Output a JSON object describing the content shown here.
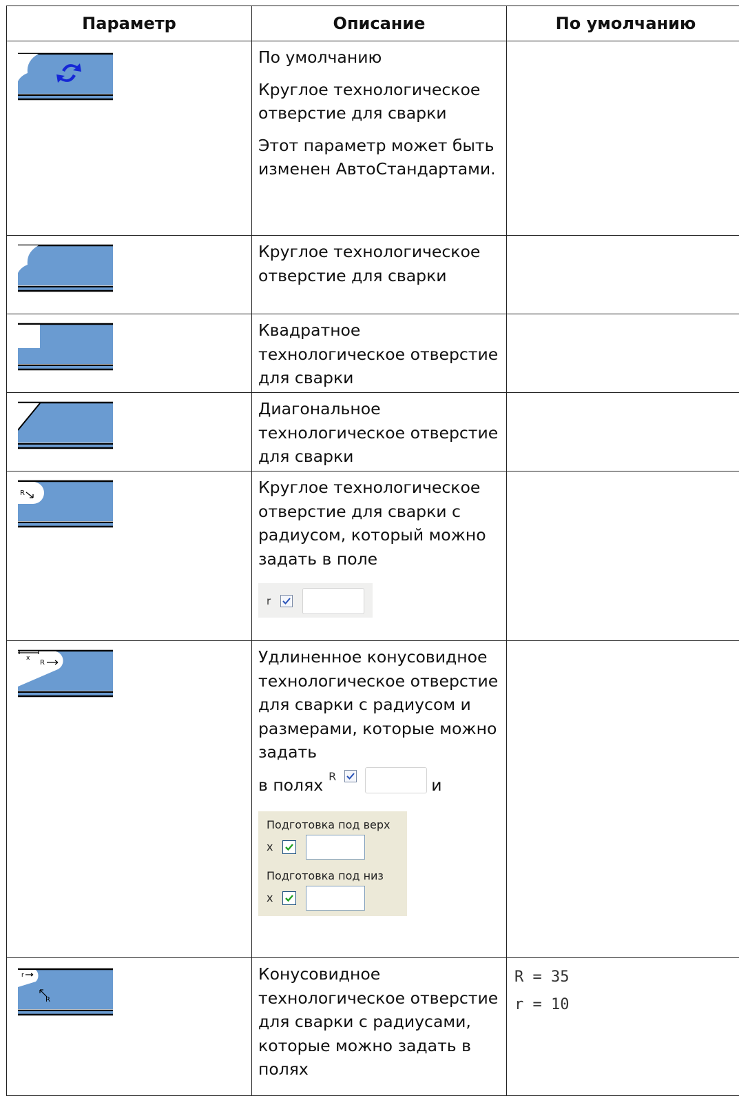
{
  "headers": [
    "Параметр",
    "Описание",
    "По умолчанию"
  ],
  "rows": [
    {
      "icon": "weld-hole-round-default-icon",
      "paras": [
        "По умолчанию",
        "Круглое технологическое отверстие для сварки",
        "Этот параметр может быть изменен АвтоСтандартами."
      ],
      "default": ""
    },
    {
      "icon": "weld-hole-round-icon",
      "paras": [
        "Круглое технологическое отверстие для сварки"
      ],
      "default": ""
    },
    {
      "icon": "weld-hole-square-icon",
      "paras": [
        "Квадратное технологическое отверстие для сварки"
      ],
      "default": ""
    },
    {
      "icon": "weld-hole-diagonal-icon",
      "paras": [
        "Диагональное технологическое отверстие для сварки"
      ],
      "default": ""
    },
    {
      "icon": "weld-hole-round-radius-icon",
      "paras": [
        "Круглое технологическое отверстие для сварки с радиусом, который можно задать в поле"
      ],
      "field_label": "r",
      "default": ""
    },
    {
      "icon": "weld-hole-elongated-cone-icon",
      "paras": [
        "Удлиненное конусовидное технологическое отверстие для сварки с радиусом и размерами, которые можно задать"
      ],
      "inline_prefix": "в полях",
      "inline_field_label": "R",
      "inline_suffix": "и",
      "prep_top_label": "Подготовка под верх",
      "prep_bottom_label": "Подготовка под низ",
      "prep_field_label": "x",
      "default": ""
    },
    {
      "icon": "weld-hole-cone-icon",
      "paras": [
        "Конусовидное технологическое отверстие для сварки с радиусами, которые можно задать в полях"
      ],
      "default_lines": [
        "R = 35",
        "r = 10"
      ]
    }
  ],
  "icon_labels": {
    "r5": "R",
    "r6_x": "x",
    "r6_R": "R",
    "r7_r": "r",
    "r7_R": "R"
  },
  "colors": {
    "fill": "#6a9bd1",
    "line": "#000000",
    "arrow": "#1526d6"
  }
}
